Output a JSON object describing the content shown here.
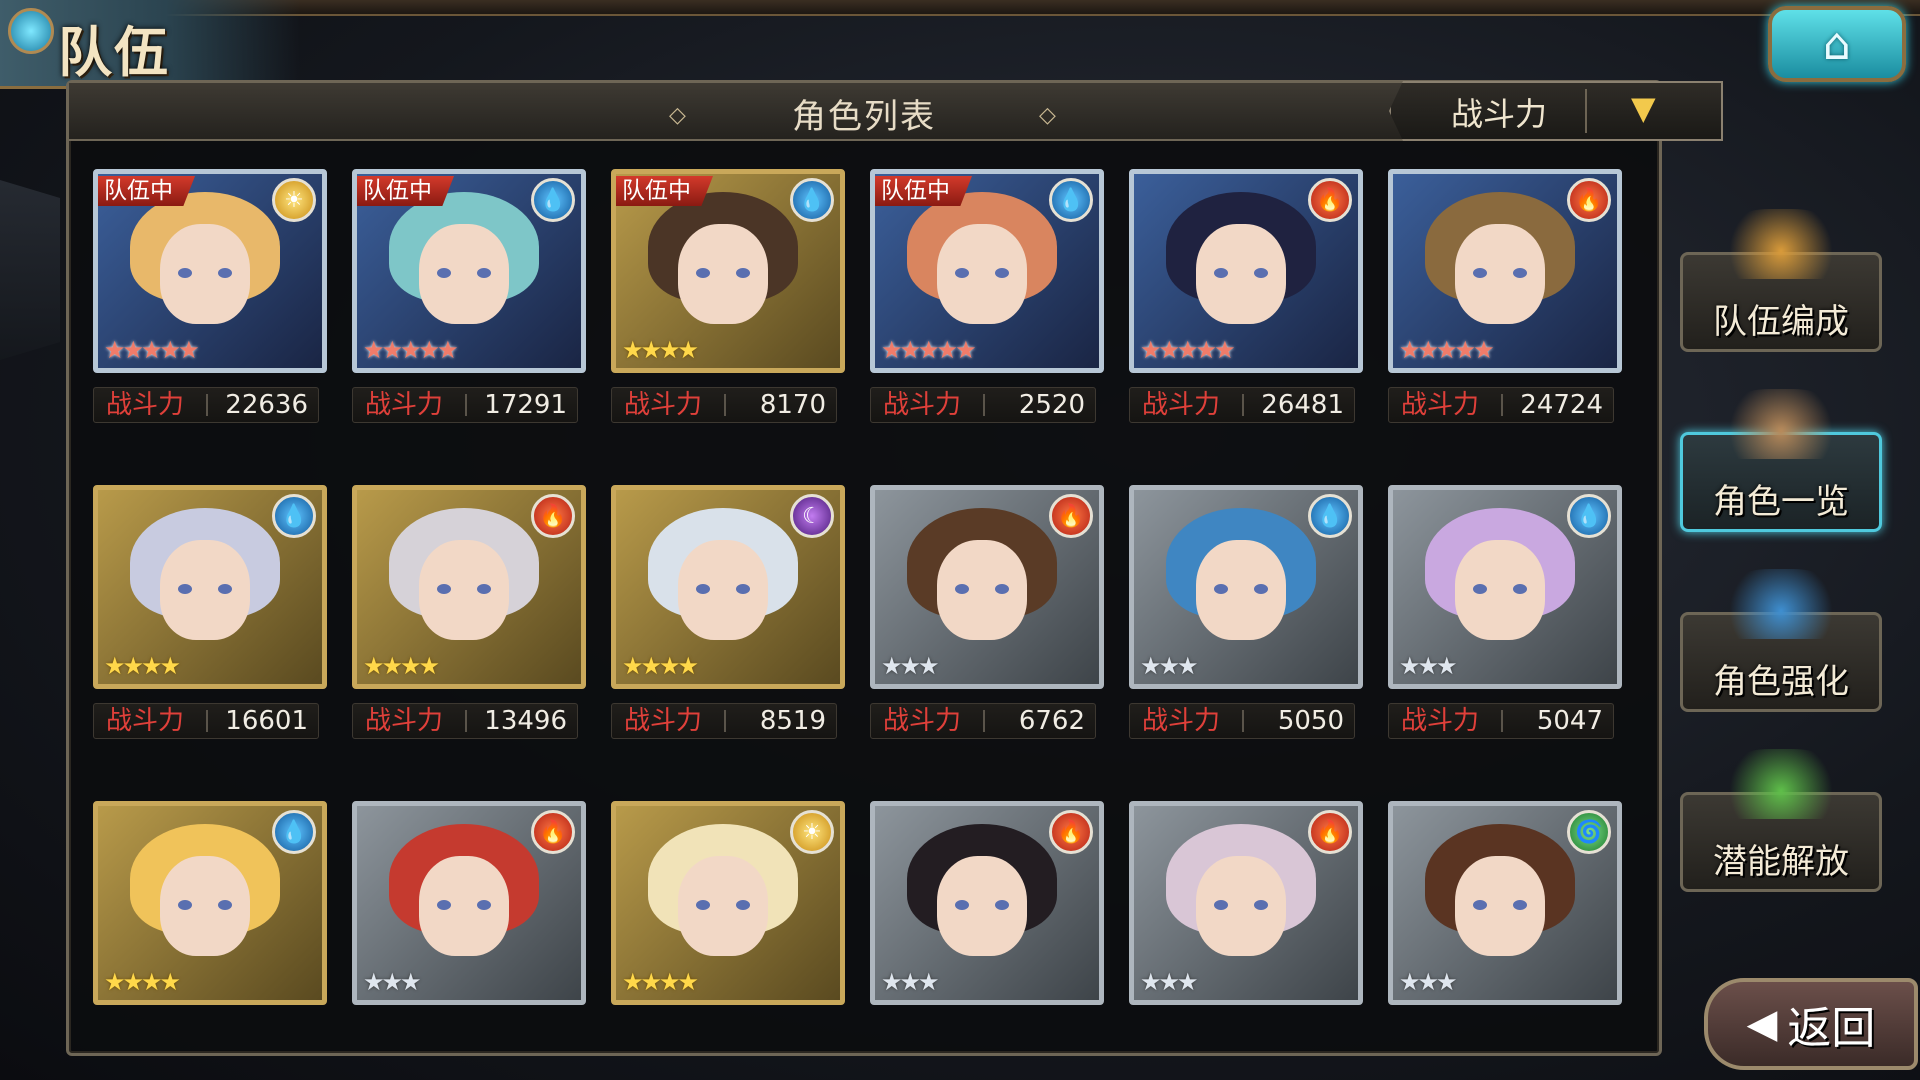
{
  "header": {
    "title": "队伍",
    "home_icon": "home-icon"
  },
  "panel": {
    "title": "角色列表",
    "sort_label": "战斗力",
    "sort_dropdown_icon": "triangle-down-icon"
  },
  "cards": [
    {
      "in_team": "队伍中",
      "element": "light",
      "element_glyph": "☀",
      "stars": "★★★★★",
      "rarity": 5,
      "frame": "ornate",
      "power_label": "战斗力",
      "power": "22636",
      "hair": "#e8b86a"
    },
    {
      "in_team": "队伍中",
      "element": "water",
      "element_glyph": "💧",
      "stars": "★★★★★",
      "rarity": 5,
      "frame": "ornate",
      "power_label": "战斗力",
      "power": "17291",
      "hair": "#7ec6c8"
    },
    {
      "in_team": "队伍中",
      "element": "water",
      "element_glyph": "💧",
      "stars": "★★★★",
      "rarity": 4,
      "frame": "gold",
      "power_label": "战斗力",
      "power": "8170",
      "hair": "#4b3526"
    },
    {
      "in_team": "队伍中",
      "element": "water",
      "element_glyph": "💧",
      "stars": "★★★★★",
      "rarity": 5,
      "frame": "ornate",
      "power_label": "战斗力",
      "power": "2520",
      "hair": "#d9855f"
    },
    {
      "in_team": "",
      "element": "fire",
      "element_glyph": "🔥",
      "stars": "★★★★★",
      "rarity": 5,
      "frame": "ornate",
      "power_label": "战斗力",
      "power": "26481",
      "hair": "#1f2240"
    },
    {
      "in_team": "",
      "element": "fire",
      "element_glyph": "🔥",
      "stars": "★★★★★",
      "rarity": 5,
      "frame": "ornate",
      "power_label": "战斗力",
      "power": "24724",
      "hair": "#8a6a3e"
    },
    {
      "in_team": "",
      "element": "water",
      "element_glyph": "💧",
      "stars": "★★★★",
      "rarity": 4,
      "frame": "gold",
      "power_label": "战斗力",
      "power": "16601",
      "hair": "#c8cbe0"
    },
    {
      "in_team": "",
      "element": "fire",
      "element_glyph": "🔥",
      "stars": "★★★★",
      "rarity": 4,
      "frame": "gold",
      "power_label": "战斗力",
      "power": "13496",
      "hair": "#d6d2d8"
    },
    {
      "in_team": "",
      "element": "dark",
      "element_glyph": "☾",
      "stars": "★★★★",
      "rarity": 4,
      "frame": "gold",
      "power_label": "战斗力",
      "power": "8519",
      "hair": "#d9e1ea"
    },
    {
      "in_team": "",
      "element": "fire",
      "element_glyph": "🔥",
      "stars": "★★★",
      "rarity": 3,
      "frame": "silver",
      "power_label": "战斗力",
      "power": "6762",
      "hair": "#5a3b26"
    },
    {
      "in_team": "",
      "element": "water",
      "element_glyph": "💧",
      "stars": "★★★",
      "rarity": 3,
      "frame": "silver",
      "power_label": "战斗力",
      "power": "5050",
      "hair": "#3f86c2"
    },
    {
      "in_team": "",
      "element": "water",
      "element_glyph": "💧",
      "stars": "★★★",
      "rarity": 3,
      "frame": "silver",
      "power_label": "战斗力",
      "power": "5047",
      "hair": "#c9a8e0"
    },
    {
      "in_team": "",
      "element": "water",
      "element_glyph": "💧",
      "stars": "★★★★",
      "rarity": 4,
      "frame": "gold",
      "hair": "#f0c35a"
    },
    {
      "in_team": "",
      "element": "fire",
      "element_glyph": "🔥",
      "stars": "★★★",
      "rarity": 3,
      "frame": "silver",
      "hair": "#c53a2f"
    },
    {
      "in_team": "",
      "element": "light",
      "element_glyph": "☀",
      "stars": "★★★★",
      "rarity": 4,
      "frame": "gold",
      "hair": "#f1e3b8"
    },
    {
      "in_team": "",
      "element": "fire",
      "element_glyph": "🔥",
      "stars": "★★★",
      "rarity": 3,
      "frame": "silver",
      "hair": "#231d22"
    },
    {
      "in_team": "",
      "element": "fire",
      "element_glyph": "🔥",
      "stars": "★★★",
      "rarity": 3,
      "frame": "silver",
      "hair": "#d9c6d6"
    },
    {
      "in_team": "",
      "element": "wind",
      "element_glyph": "🌀",
      "stars": "★★★",
      "rarity": 3,
      "frame": "silver",
      "hair": "#5a3422"
    }
  ],
  "side_menu": [
    {
      "label": "队伍编成",
      "icon": "team-characters-icon",
      "active": false,
      "icon_color": "#d99b3a"
    },
    {
      "label": "角色一览",
      "icon": "book-icon",
      "active": true,
      "icon_color": "#b88a5a"
    },
    {
      "label": "角色强化",
      "icon": "card-upgrade-icon",
      "active": false,
      "icon_color": "#3f8fd0"
    },
    {
      "label": "潜能解放",
      "icon": "potential-orb-icon",
      "active": false,
      "icon_color": "#5fbf4a"
    }
  ],
  "back_button": {
    "label": "返回",
    "icon": "back-arrow-icon"
  }
}
